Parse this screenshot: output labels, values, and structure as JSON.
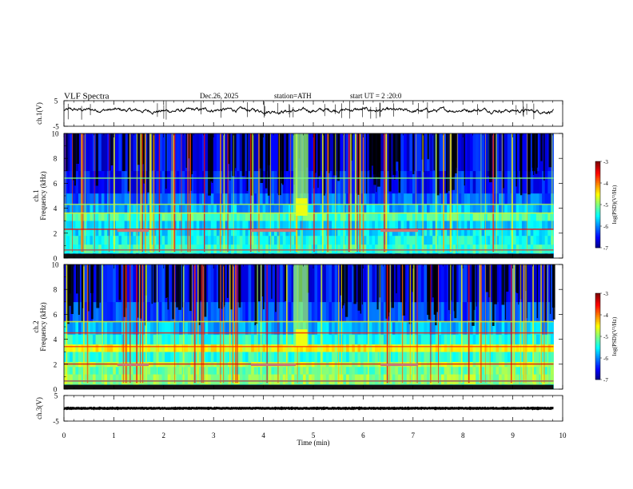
{
  "header": {
    "title": "VLF  Spectra",
    "date": "Dec.26, 2025",
    "station": "station=ATH",
    "start": "start  UT  =   2  :20:0"
  },
  "chart_data": [
    {
      "type": "line",
      "ylabel": "ch.1(V)",
      "ylim": [
        -5,
        5
      ],
      "yticks": [
        "5",
        "-5"
      ],
      "baseline": 1.2,
      "color": "#000000"
    },
    {
      "type": "heatmap",
      "ylabel_top": "ch.1",
      "ylabel": "Frequency  (kHz)",
      "ylim": [
        0,
        10
      ],
      "yticks": [
        "0",
        "2",
        "4",
        "6",
        "8",
        "10"
      ],
      "colorbar": {
        "label": "log(PSD)(V²/Hz)",
        "range": [
          -7,
          -3
        ],
        "ticks": [
          "-3",
          "-4",
          "-5",
          "-6",
          "-7"
        ]
      }
    },
    {
      "type": "heatmap",
      "ylabel_top": "ch.2",
      "ylabel": "Frequency  (kHz)",
      "ylim": [
        0,
        10
      ],
      "yticks": [
        "0",
        "2",
        "4",
        "6",
        "8",
        "10"
      ],
      "colorbar": {
        "label": "log(PSD)(V²/Hz)",
        "range": [
          -7,
          -3
        ],
        "ticks": [
          "-3",
          "-4",
          "-5",
          "-6",
          "-7"
        ]
      }
    },
    {
      "type": "line",
      "ylabel": "ch.3(V)",
      "ylim": [
        -5,
        5
      ],
      "yticks": [
        "5",
        "-5"
      ],
      "baseline": 0,
      "color": "#000000"
    }
  ],
  "xaxis": {
    "label": "Time  (min)",
    "xlim": [
      0,
      10
    ],
    "ticks": [
      "0",
      "1",
      "2",
      "3",
      "4",
      "5",
      "6",
      "7",
      "8",
      "9",
      "10"
    ]
  }
}
